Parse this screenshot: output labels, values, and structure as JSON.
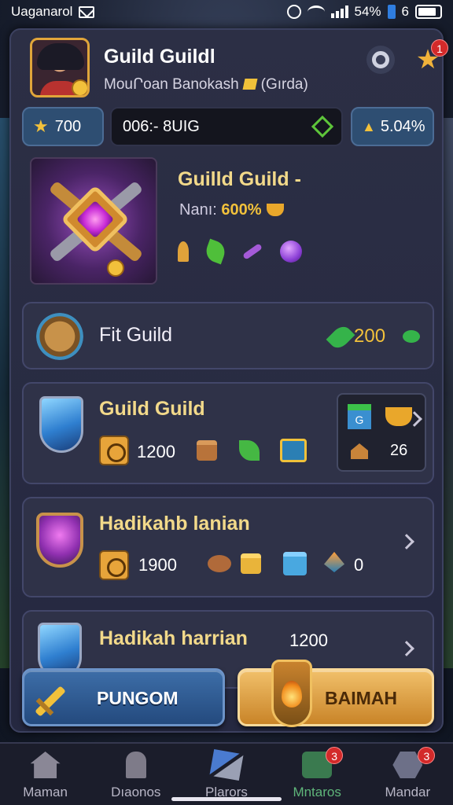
{
  "status_bar": {
    "carrier": "Uaganarol",
    "battery_text": "54%",
    "extra": "6"
  },
  "header": {
    "title": "Guild Guildl",
    "subtitle_left": "MouՐoan Banokash",
    "subtitle_right": "(Gırda)",
    "star_badge": "1"
  },
  "currency": {
    "left_value": "700",
    "code": "006:- 8UIG",
    "right_value": "5.04%"
  },
  "featured": {
    "title": "Guilld Guild -",
    "rate_label": "Nanı:",
    "rate_value": "600%"
  },
  "rows": [
    {
      "label": "Fit Guild",
      "value": "200"
    },
    {
      "label": "Guild Guild",
      "count": "1200",
      "side_code": "G",
      "side_count": "26"
    },
    {
      "label": "Hadikahb lanian",
      "count": "1900",
      "extra": "0"
    },
    {
      "label": "Hadikah harrian",
      "count": "1200"
    }
  ],
  "actions": {
    "primary": "PUNGOM",
    "secondary": "BAIMAH"
  },
  "nav": [
    {
      "label": "Maman",
      "icon": "home-icon"
    },
    {
      "label": "Dıaonos",
      "icon": "tower-icon"
    },
    {
      "label": "Plarors",
      "icon": "tools-icon"
    },
    {
      "label": "Mntaros",
      "icon": "chat-icon",
      "badge": "3"
    },
    {
      "label": "Mandar",
      "icon": "hex-icon",
      "badge": "3"
    }
  ],
  "colors": {
    "accent_gold": "#f2c13b",
    "panel_bg": "#2c2f45",
    "active_nav": "#5fb57a"
  }
}
